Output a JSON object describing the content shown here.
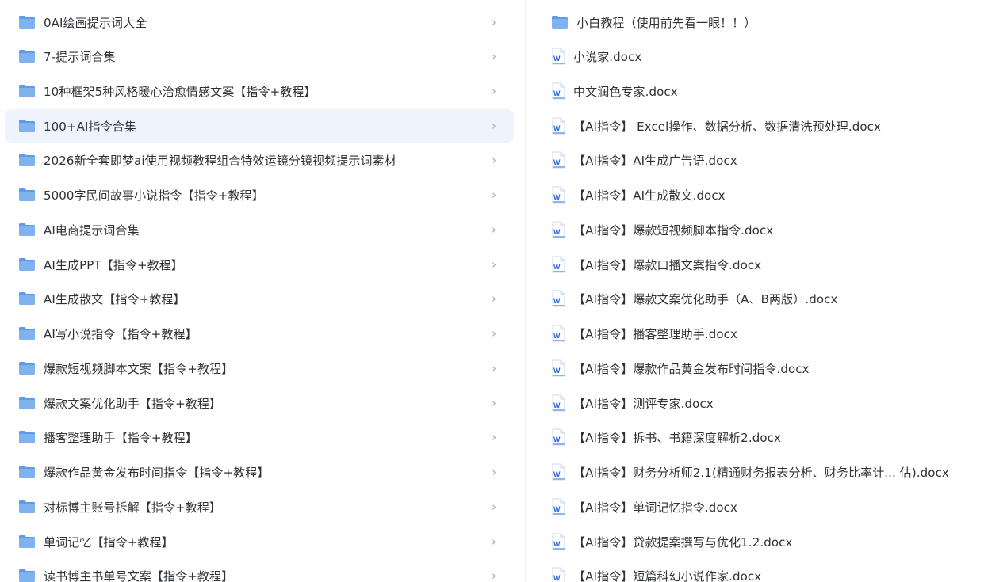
{
  "left": {
    "items": [
      {
        "label": "0AI绘画提示词大全",
        "icon": "folder-icon"
      },
      {
        "label": "7-提示词合集",
        "icon": "folder-icon"
      },
      {
        "label": "10种框架5种风格暖心治愈情感文案【指令+教程】",
        "icon": "folder-icon"
      },
      {
        "label": "100+AI指令合集",
        "icon": "folder-icon",
        "selected": true
      },
      {
        "label": "2026新全套即梦ai使用视频教程组合特效运镜分镜视频提示词素材",
        "icon": "folder-icon"
      },
      {
        "label": "5000字民间故事小说指令【指令+教程】",
        "icon": "folder-icon"
      },
      {
        "label": "AI电商提示词合集",
        "icon": "folder-icon"
      },
      {
        "label": "AI生成PPT【指令+教程】",
        "icon": "folder-icon"
      },
      {
        "label": "AI生成散文【指令+教程】",
        "icon": "folder-icon"
      },
      {
        "label": "AI写小说指令【指令+教程】",
        "icon": "folder-icon"
      },
      {
        "label": "爆款短视频脚本文案【指令+教程】",
        "icon": "folder-icon"
      },
      {
        "label": "爆款文案优化助手【指令+教程】",
        "icon": "folder-icon"
      },
      {
        "label": "播客整理助手【指令+教程】",
        "icon": "folder-icon"
      },
      {
        "label": "爆款作品黄金发布时间指令【指令+教程】",
        "icon": "folder-icon"
      },
      {
        "label": "对标博主账号拆解【指令+教程】",
        "icon": "folder-icon"
      },
      {
        "label": "单词记忆【指令+教程】",
        "icon": "folder-icon"
      },
      {
        "label": "读书博主书单号文案【指令+教程】",
        "icon": "folder-icon"
      }
    ],
    "chevron": "›"
  },
  "right": {
    "items": [
      {
        "label": "小白教程（使用前先看一眼！！）",
        "icon": "folder-icon"
      },
      {
        "label": "小说家.docx",
        "icon": "word-doc-icon"
      },
      {
        "label": "中文润色专家.docx",
        "icon": "word-doc-icon"
      },
      {
        "label": "【AI指令】 Excel操作、数据分析、数据清洗预处理.docx",
        "icon": "word-doc-icon"
      },
      {
        "label": "【AI指令】AI生成广告语.docx",
        "icon": "word-doc-icon"
      },
      {
        "label": "【AI指令】AI生成散文.docx",
        "icon": "word-doc-icon"
      },
      {
        "label": "【AI指令】爆款短视频脚本指令.docx",
        "icon": "word-doc-icon"
      },
      {
        "label": "【AI指令】爆款口播文案指令.docx",
        "icon": "word-doc-icon"
      },
      {
        "label": "【AI指令】爆款文案优化助手（A、B两版）.docx",
        "icon": "word-doc-icon"
      },
      {
        "label": "【AI指令】播客整理助手.docx",
        "icon": "word-doc-icon"
      },
      {
        "label": "【AI指令】爆款作品黄金发布时间指令.docx",
        "icon": "word-doc-icon"
      },
      {
        "label": "【AI指令】测评专家.docx",
        "icon": "word-doc-icon"
      },
      {
        "label": "【AI指令】拆书、书籍深度解析2.docx",
        "icon": "word-doc-icon"
      },
      {
        "label": "【AI指令】财务分析师2.1(精通财务报表分析、财务比率计...  估).docx",
        "icon": "word-doc-icon"
      },
      {
        "label": "【AI指令】单词记忆指令.docx",
        "icon": "word-doc-icon"
      },
      {
        "label": "【AI指令】贷款提案撰写与优化1.2.docx",
        "icon": "word-doc-icon"
      },
      {
        "label": "【AI指令】短篇科幻小说作家.docx",
        "icon": "word-doc-icon"
      }
    ],
    "word_badge": "W"
  },
  "colors": {
    "folder": "#7fb3f0",
    "folder_tab": "#5e9ae8",
    "word_blue": "#2b66d6",
    "selected_bg": "#eef3fd",
    "chevron": "#a3a8b1",
    "text": "#2f3136"
  }
}
